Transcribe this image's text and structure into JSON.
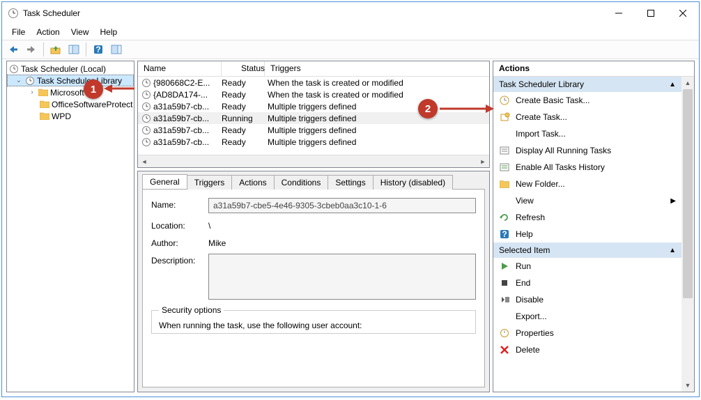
{
  "window": {
    "title": "Task Scheduler"
  },
  "menu": {
    "file": "File",
    "action": "Action",
    "view": "View",
    "help": "Help"
  },
  "tree": {
    "root": "Task Scheduler (Local)",
    "library": "Task Scheduler Library",
    "children": [
      "Microsoft",
      "OfficeSoftwareProtect",
      "WPD"
    ]
  },
  "columns": {
    "name": "Name",
    "status": "Status",
    "triggers": "Triggers"
  },
  "tasks": [
    {
      "name": "{980668C2-E...",
      "status": "Ready",
      "triggers": "When the task is created or modified"
    },
    {
      "name": "{AD8DA174-...",
      "status": "Ready",
      "triggers": "When the task is created or modified"
    },
    {
      "name": "a31a59b7-cb...",
      "status": "Ready",
      "triggers": "Multiple triggers defined"
    },
    {
      "name": "a31a59b7-cb...",
      "status": "Running",
      "triggers": "Multiple triggers defined"
    },
    {
      "name": "a31a59b7-cb...",
      "status": "Ready",
      "triggers": "Multiple triggers defined"
    },
    {
      "name": "a31a59b7-cb...",
      "status": "Ready",
      "triggers": "Multiple triggers defined"
    }
  ],
  "tabs": {
    "general": "General",
    "triggers": "Triggers",
    "actions": "Actions",
    "conditions": "Conditions",
    "settings": "Settings",
    "history": "History (disabled)"
  },
  "details": {
    "name_label": "Name:",
    "name_value": "a31a59b7-cbe5-4e46-9305-3cbeb0aa3c10-1-6",
    "location_label": "Location:",
    "location_value": "\\",
    "author_label": "Author:",
    "author_value": "Mike",
    "description_label": "Description:",
    "security_legend": "Security options",
    "security_text": "When running the task, use the following user account:"
  },
  "actions": {
    "header": "Actions",
    "section1": "Task Scheduler Library",
    "section2": "Selected Item",
    "items1": [
      {
        "icon": "task-basic",
        "label": "Create Basic Task..."
      },
      {
        "icon": "task-create",
        "label": "Create Task..."
      },
      {
        "icon": "blank",
        "label": "Import Task..."
      },
      {
        "icon": "display-tasks",
        "label": "Display All Running Tasks"
      },
      {
        "icon": "enable-history",
        "label": "Enable All Tasks History"
      },
      {
        "icon": "folder",
        "label": "New Folder..."
      },
      {
        "icon": "blank",
        "label": "View",
        "submenu": true
      },
      {
        "icon": "refresh",
        "label": "Refresh"
      },
      {
        "icon": "help",
        "label": "Help"
      }
    ],
    "items2": [
      {
        "icon": "run",
        "label": "Run"
      },
      {
        "icon": "end",
        "label": "End"
      },
      {
        "icon": "disable",
        "label": "Disable"
      },
      {
        "icon": "blank",
        "label": "Export..."
      },
      {
        "icon": "properties",
        "label": "Properties"
      },
      {
        "icon": "delete",
        "label": "Delete"
      }
    ]
  },
  "annotations": {
    "badge1": "1",
    "badge2": "2"
  }
}
